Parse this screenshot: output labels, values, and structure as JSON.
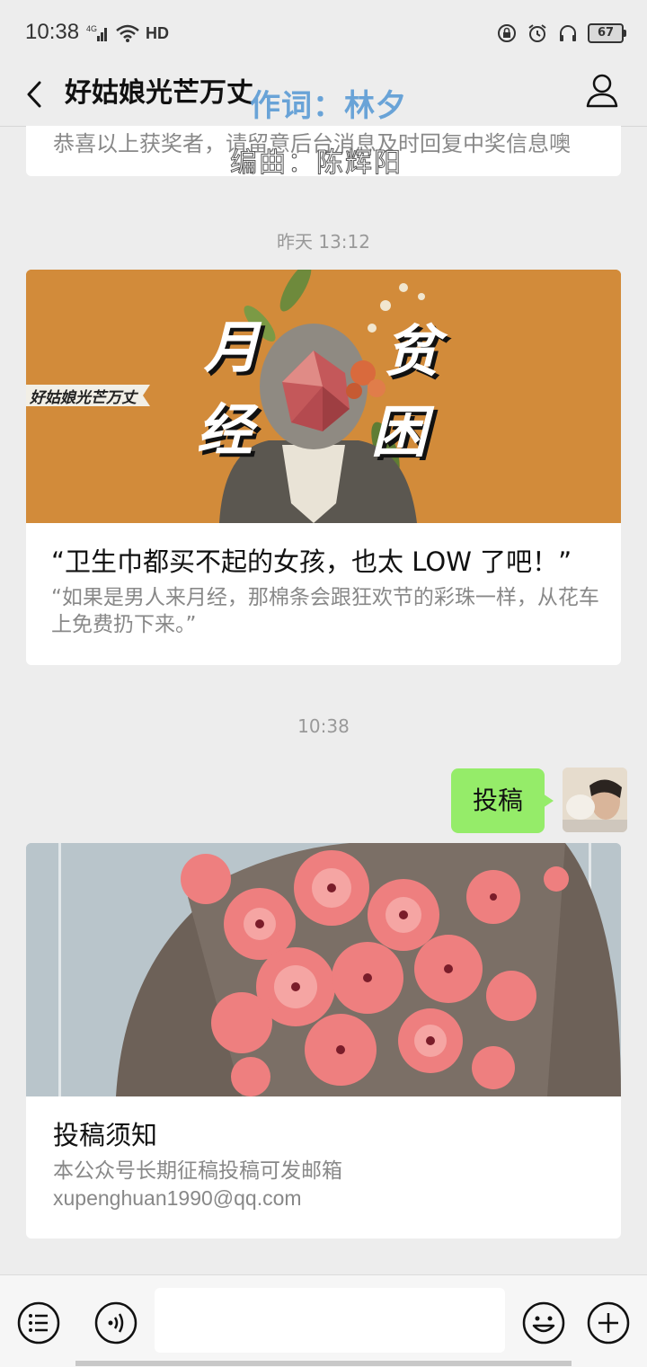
{
  "status_bar": {
    "time": "10:38",
    "network": "4G",
    "hd": "HD",
    "battery": "67"
  },
  "header": {
    "title": "好姑娘光芒万丈",
    "overlay_lyric_1": "作词：林夕",
    "overlay_lyric_2": "编曲：陈辉阳"
  },
  "messages": {
    "prev_card_text": "恭喜以上获奖者，请留意后台消息及时回复中奖信息噢",
    "timestamp_1": "昨天 13:12",
    "article_1": {
      "image_text_1": "月",
      "image_text_2": "经",
      "image_text_3": "贫",
      "image_text_4": "困",
      "image_banner": "好姑娘光芒万丈",
      "title": "“卫生巾都买不起的女孩，也太 LOW 了吧！”",
      "desc": "“如果是男人来月经，那棉条会跟狂欢节的彩珠一样，从花车上免费扔下来。”"
    },
    "timestamp_2": "10:38",
    "outgoing_text": "投稿",
    "article_2": {
      "title": "投稿须知",
      "desc_line_1": "本公众号长期征稿投稿可发邮箱",
      "desc_line_2": "xupenghuan1990@qq.com"
    }
  },
  "colors": {
    "bubble": "#95ec69",
    "background": "#ededed",
    "card_orange": "#d28b3a"
  }
}
